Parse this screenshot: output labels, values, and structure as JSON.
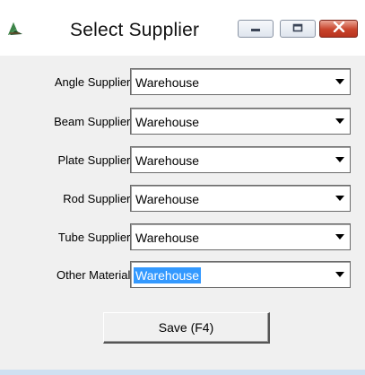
{
  "window": {
    "title": "Select Supplier",
    "icon": "app-logo-icon",
    "controls": [
      "minimize-icon",
      "maximize-icon",
      "close-icon"
    ]
  },
  "fields": [
    {
      "label": "Angle Supplier:",
      "value": "Warehouse"
    },
    {
      "label": "Beam Supplier:",
      "value": "Warehouse"
    },
    {
      "label": "Plate Supplier:",
      "value": "Warehouse"
    },
    {
      "label": "Rod Supplier:",
      "value": "Warehouse"
    },
    {
      "label": "Tube Supplier:",
      "value": "Warehouse"
    },
    {
      "label": "Other Material:",
      "value": "Warehouse"
    }
  ],
  "save_button": {
    "label": "Save (F4)"
  },
  "colors": {
    "selection": "#3399ff",
    "close_button": "#c8432b",
    "dialog_background": "#f0f0f0"
  }
}
